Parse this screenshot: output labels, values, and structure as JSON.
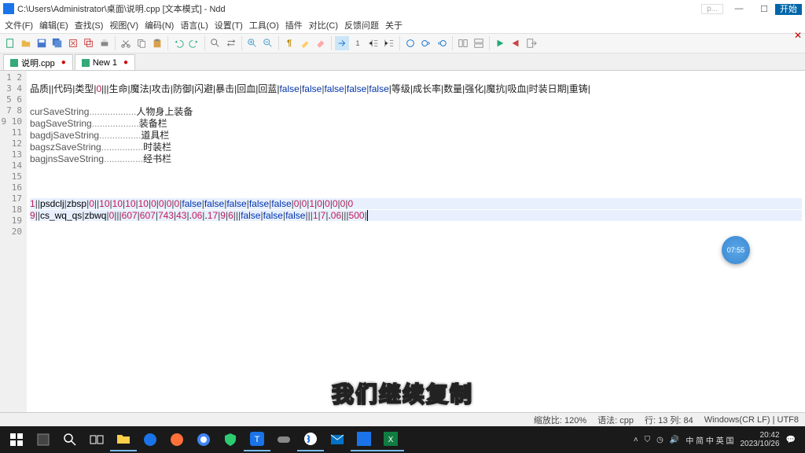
{
  "window": {
    "title": "C:\\Users\\Administrator\\桌面\\说明.cpp [文本模式] - Ndd",
    "runlabel": "开始",
    "p": "p..."
  },
  "menu": [
    "文件(F)",
    "编辑(E)",
    "查找(S)",
    "视图(V)",
    "编码(N)",
    "语言(L)",
    "设置(T)",
    "工具(O)",
    "插件",
    "对比(C)",
    "反馈问题",
    "关于"
  ],
  "tabs": [
    {
      "label": "说明.cpp",
      "dirty": true
    },
    {
      "label": "New 1",
      "dirty": true
    }
  ],
  "gutter_lines": 20,
  "code": {
    "line2": {
      "han": "品质||代码|类型|",
      "zero": "0",
      "han2": "|||生命|魔法|攻击|防御|闪避|暴击|回血|回蓝|",
      "falses": "false|false|false|false|false",
      "han3": "|等级|成长率|数量|强化|魔抗|吸血|时装日期|重铸|"
    },
    "line4": {
      "ident": "curSaveString",
      "dots": "..................",
      "han": "人物身上装备"
    },
    "line5": {
      "ident": "bagSaveString",
      "dots": "..................",
      "han": "装备栏"
    },
    "line6": {
      "ident": "bagdjSaveString",
      "dots": "................",
      "han": "道具栏"
    },
    "line7": {
      "ident": "bagszSaveString",
      "dots": "................",
      "han": "时装栏"
    },
    "line8": {
      "ident": "bagjnsSaveString",
      "dots": "...............",
      "han": "经书栏"
    },
    "line12": "1||psdclj|zbsp|0||10|10|10|10|0|0|0|0|false|false|false|false|false|0|0|1|0|0|0|0|0",
    "line13": "9||cs_wq_qs|zbwq|0|||607|607|743|43|.06|.17|9|6|||false|false|false|||1|7|.06|||500|"
  },
  "timer": "07:55",
  "subtitle": "我们继续复制",
  "status": {
    "zoom": "缩放比: 120%",
    "lang": "语法: cpp",
    "pos": "行: 13 列: 84",
    "enc": "Windows(CR LF)  | UTF8"
  },
  "tray": {
    "ime": "中 简 中 英 国",
    "time": "20:42",
    "date": "2023/10/26"
  }
}
